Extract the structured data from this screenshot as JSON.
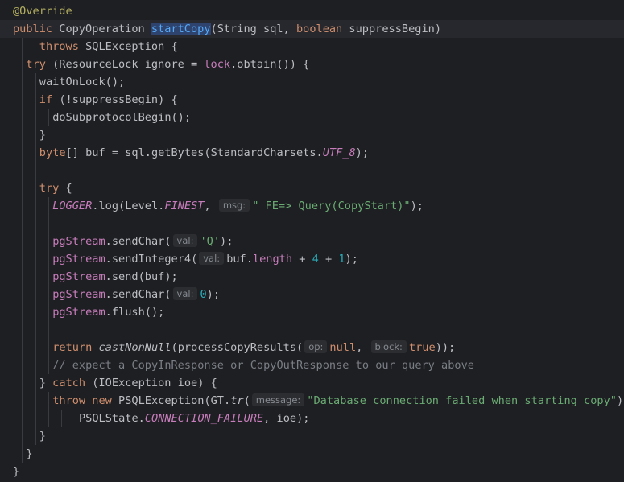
{
  "editor": {
    "background": "#1e1f22",
    "colors": {
      "keyword": "#cf8e6d",
      "annotation": "#b3ae60",
      "function_declaration": "#56a8f5",
      "string": "#6aab73",
      "number": "#2aacb8",
      "constant_field": "#c77dbb",
      "comment": "#7a7e85",
      "text": "#bcbec4",
      "inlay_hint_text": "#868a91",
      "inlay_hint_background": "#2b2d30"
    },
    "lines": [
      {
        "current": false,
        "indent": 0,
        "guides": [],
        "tokens": [
          {
            "t": "@Override",
            "c": "ann"
          }
        ]
      },
      {
        "current": true,
        "indent": 0,
        "guides": [],
        "tokens": [
          {
            "t": "public",
            "c": "kw"
          },
          {
            "t": " CopyOperation ",
            "c": "txt"
          },
          {
            "t": "startCopy",
            "c": "fn decl-hl"
          },
          {
            "t": "(String sql, ",
            "c": "txt"
          },
          {
            "t": "boolean",
            "c": "kw"
          },
          {
            "t": " suppressBegin)",
            "c": "txt"
          }
        ]
      },
      {
        "current": false,
        "indent": 4,
        "guides": [
          1
        ],
        "tokens": [
          {
            "t": "throws",
            "c": "kw"
          },
          {
            "t": " SQLException {",
            "c": "txt"
          }
        ]
      },
      {
        "current": false,
        "indent": 2,
        "guides": [
          1
        ],
        "tokens": [
          {
            "t": "try",
            "c": "kw"
          },
          {
            "t": " (ResourceLock ignore = ",
            "c": "txt"
          },
          {
            "t": "lock",
            "c": "fld"
          },
          {
            "t": ".obtain()) {",
            "c": "txt"
          }
        ]
      },
      {
        "current": false,
        "indent": 4,
        "guides": [
          1,
          3
        ],
        "tokens": [
          {
            "t": "waitOnLock();",
            "c": "txt"
          }
        ]
      },
      {
        "current": false,
        "indent": 4,
        "guides": [
          1,
          3
        ],
        "tokens": [
          {
            "t": "if",
            "c": "kw"
          },
          {
            "t": " (!suppressBegin) {",
            "c": "txt"
          }
        ]
      },
      {
        "current": false,
        "indent": 6,
        "guides": [
          1,
          3,
          5
        ],
        "tokens": [
          {
            "t": "doSubprotocolBegin();",
            "c": "txt"
          }
        ]
      },
      {
        "current": false,
        "indent": 4,
        "guides": [
          1,
          3
        ],
        "tokens": [
          {
            "t": "}",
            "c": "txt"
          }
        ]
      },
      {
        "current": false,
        "indent": 4,
        "guides": [
          1,
          3
        ],
        "tokens": [
          {
            "t": "byte",
            "c": "kw"
          },
          {
            "t": "[] buf = sql.getBytes(StandardCharsets.",
            "c": "txt"
          },
          {
            "t": "UTF_8",
            "c": "const"
          },
          {
            "t": ");",
            "c": "txt"
          }
        ]
      },
      {
        "current": false,
        "indent": 0,
        "guides": [
          1,
          3
        ],
        "tokens": []
      },
      {
        "current": false,
        "indent": 4,
        "guides": [
          1,
          3
        ],
        "tokens": [
          {
            "t": "try",
            "c": "kw"
          },
          {
            "t": " {",
            "c": "txt"
          }
        ]
      },
      {
        "current": false,
        "indent": 6,
        "guides": [
          1,
          3,
          5
        ],
        "tokens": [
          {
            "t": "LOGGER",
            "c": "const"
          },
          {
            "t": ".log(Level.",
            "c": "txt"
          },
          {
            "t": "FINEST",
            "c": "const"
          },
          {
            "t": ", ",
            "c": "txt"
          },
          {
            "hint": "msg:"
          },
          {
            "t": "\" FE=> Query(CopyStart)\"",
            "c": "str"
          },
          {
            "t": ");",
            "c": "txt"
          }
        ]
      },
      {
        "current": false,
        "indent": 0,
        "guides": [
          1,
          3,
          5
        ],
        "tokens": []
      },
      {
        "current": false,
        "indent": 6,
        "guides": [
          1,
          3,
          5
        ],
        "tokens": [
          {
            "t": "pgStream",
            "c": "fld"
          },
          {
            "t": ".sendChar(",
            "c": "txt"
          },
          {
            "hint": "val:"
          },
          {
            "t": "'Q'",
            "c": "str"
          },
          {
            "t": ");",
            "c": "txt"
          }
        ]
      },
      {
        "current": false,
        "indent": 6,
        "guides": [
          1,
          3,
          5
        ],
        "tokens": [
          {
            "t": "pgStream",
            "c": "fld"
          },
          {
            "t": ".sendInteger4(",
            "c": "txt"
          },
          {
            "hint": "val:"
          },
          {
            "t": "buf.",
            "c": "txt"
          },
          {
            "t": "length",
            "c": "fld"
          },
          {
            "t": " + ",
            "c": "txt"
          },
          {
            "t": "4",
            "c": "num"
          },
          {
            "t": " + ",
            "c": "txt"
          },
          {
            "t": "1",
            "c": "num"
          },
          {
            "t": ");",
            "c": "txt"
          }
        ]
      },
      {
        "current": false,
        "indent": 6,
        "guides": [
          1,
          3,
          5
        ],
        "tokens": [
          {
            "t": "pgStream",
            "c": "fld"
          },
          {
            "t": ".send(buf);",
            "c": "txt"
          }
        ]
      },
      {
        "current": false,
        "indent": 6,
        "guides": [
          1,
          3,
          5
        ],
        "tokens": [
          {
            "t": "pgStream",
            "c": "fld"
          },
          {
            "t": ".sendChar(",
            "c": "txt"
          },
          {
            "hint": "val:"
          },
          {
            "t": "0",
            "c": "num"
          },
          {
            "t": ");",
            "c": "txt"
          }
        ]
      },
      {
        "current": false,
        "indent": 6,
        "guides": [
          1,
          3,
          5
        ],
        "tokens": [
          {
            "t": "pgStream",
            "c": "fld"
          },
          {
            "t": ".flush();",
            "c": "txt"
          }
        ]
      },
      {
        "current": false,
        "indent": 0,
        "guides": [
          1,
          3,
          5
        ],
        "tokens": []
      },
      {
        "current": false,
        "indent": 6,
        "guides": [
          1,
          3,
          5
        ],
        "tokens": [
          {
            "t": "return",
            "c": "kw"
          },
          {
            "t": " ",
            "c": "txt"
          },
          {
            "t": "castNonNull",
            "c": "txt italic"
          },
          {
            "t": "(processCopyResults(",
            "c": "txt"
          },
          {
            "hint": "op:"
          },
          {
            "t": "null",
            "c": "kw"
          },
          {
            "t": ", ",
            "c": "txt"
          },
          {
            "hint": "block:"
          },
          {
            "t": "true",
            "c": "kw"
          },
          {
            "t": "));",
            "c": "txt"
          }
        ]
      },
      {
        "current": false,
        "indent": 6,
        "guides": [
          1,
          3,
          5
        ],
        "tokens": [
          {
            "t": "// expect a CopyInResponse or CopyOutResponse to our query above",
            "c": "cmt"
          }
        ]
      },
      {
        "current": false,
        "indent": 4,
        "guides": [
          1,
          3
        ],
        "tokens": [
          {
            "t": "} ",
            "c": "txt"
          },
          {
            "t": "catch",
            "c": "kw"
          },
          {
            "t": " (IOException ioe) {",
            "c": "txt"
          }
        ]
      },
      {
        "current": false,
        "indent": 6,
        "guides": [
          1,
          3,
          5
        ],
        "tokens": [
          {
            "t": "throw",
            "c": "kw"
          },
          {
            "t": " ",
            "c": "txt"
          },
          {
            "t": "new",
            "c": "kw"
          },
          {
            "t": " PSQLException(GT.",
            "c": "txt"
          },
          {
            "t": "tr",
            "c": "txt italic"
          },
          {
            "t": "(",
            "c": "txt"
          },
          {
            "hint": "message:"
          },
          {
            "t": "\"Database connection failed when starting copy\"",
            "c": "str"
          },
          {
            "t": "),",
            "c": "txt"
          }
        ]
      },
      {
        "current": false,
        "indent": 10,
        "guides": [
          1,
          3,
          5,
          7
        ],
        "tokens": [
          {
            "t": "PSQLState.",
            "c": "txt"
          },
          {
            "t": "CONNECTION_FAILURE",
            "c": "const"
          },
          {
            "t": ", ioe);",
            "c": "txt"
          }
        ]
      },
      {
        "current": false,
        "indent": 4,
        "guides": [
          1,
          3
        ],
        "tokens": [
          {
            "t": "}",
            "c": "txt"
          }
        ]
      },
      {
        "current": false,
        "indent": 2,
        "guides": [
          1
        ],
        "tokens": [
          {
            "t": "}",
            "c": "txt"
          }
        ]
      },
      {
        "current": false,
        "indent": 0,
        "guides": [],
        "tokens": [
          {
            "t": "}",
            "c": "txt"
          }
        ]
      }
    ]
  }
}
